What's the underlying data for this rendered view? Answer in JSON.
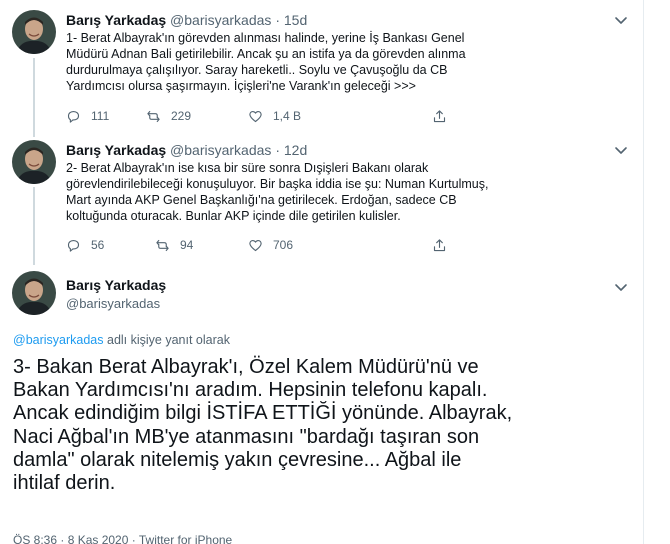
{
  "tweets": [
    {
      "name": "Barış Yarkadaş",
      "handle": "@barisyarkadas",
      "dot": "·",
      "time": "15d",
      "lines": [
        "1- Berat Albayrak'ın görevden alınması halinde, yerine İş Bankası Genel",
        "Müdürü Adnan Bali getirilebilir. Ancak şu an istifa ya da görevden alınma",
        "durdurulmaya çalışılıyor. Saray hareketli.. Soylu ve Çavuşoğlu da CB",
        "Yardımcısı olursa şaşırmayın. İçişleri'ne Varank'ın geleceği >>>"
      ],
      "replies": "111",
      "retweets": "229",
      "likes": "1,4 B"
    },
    {
      "name": "Barış Yarkadaş",
      "handle": "@barisyarkadas",
      "dot": "·",
      "time": "12d",
      "lines": [
        "2- Berat Albayrak'ın ise kısa bir süre sonra Dışişleri Bakanı olarak",
        "görevlendirilebileceği konuşuluyor. Bir başka iddia ise şu: Numan Kurtulmuş,",
        "Mart ayında AKP Genel Başkanlığı'na getirilecek. Erdoğan, sadece CB",
        "koltuğunda oturacak. Bunlar AKP içinde dile getirilen kulisler."
      ],
      "replies": "56",
      "retweets": "94",
      "likes": "706"
    }
  ],
  "main": {
    "name": "Barış Yarkadaş",
    "handle": "@barisyarkadas",
    "reply_link": "@barisyarkadas",
    "reply_suffix": " adlı kişiye yanıt olarak",
    "lines": [
      "3- Bakan Berat Albayrak'ı, Özel Kalem Müdürü'nü ve",
      "Bakan Yardımcısı'nı aradım. Hepsinin telefonu kapalı.",
      "Ancak edindiğim bilgi İSTİFA ETTİĞİ yönünde. Albayrak,",
      "Naci Ağbal'ın MB'ye atanmasını \"bardağı taşıran son",
      "damla\" olarak nitelemiş yakın çevresine... Ağbal ile",
      "ihtilaf derin."
    ],
    "footer": "ÖS 8:36 · 8 Kas 2020 · Twitter for iPhone"
  },
  "icons": {
    "reply": "reply-icon",
    "retweet": "retweet-icon",
    "like": "heart-icon",
    "share": "share-icon",
    "more": "chevron-down-icon"
  },
  "colors": {
    "link": "#1d9bf0",
    "muted": "#536471",
    "text": "#0f1419",
    "thread_line": "#cfd9de"
  }
}
